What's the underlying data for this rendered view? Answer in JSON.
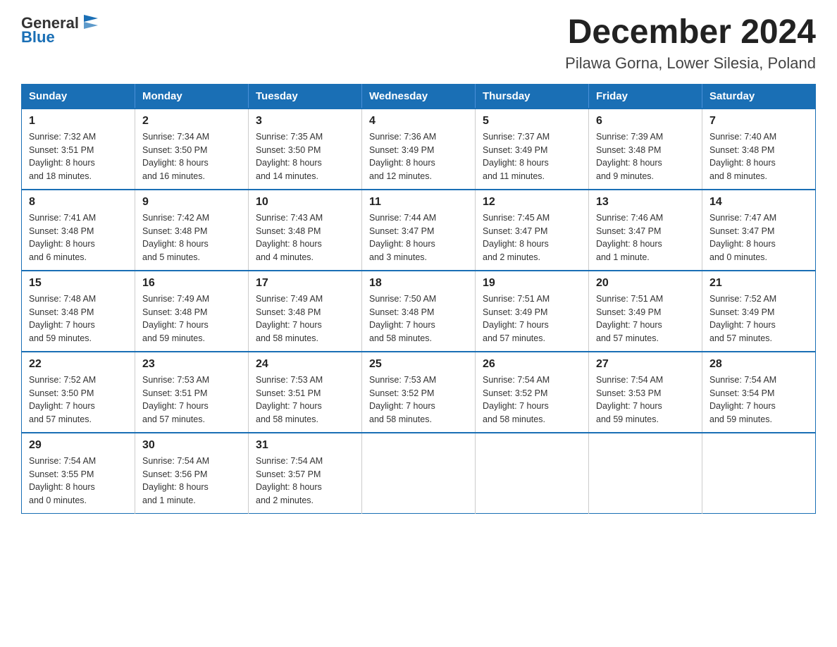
{
  "header": {
    "logo_text_general": "General",
    "logo_text_blue": "Blue",
    "title": "December 2024",
    "subtitle": "Pilawa Gorna, Lower Silesia, Poland"
  },
  "days_of_week": [
    "Sunday",
    "Monday",
    "Tuesday",
    "Wednesday",
    "Thursday",
    "Friday",
    "Saturday"
  ],
  "weeks": [
    [
      {
        "day": "1",
        "sunrise": "7:32 AM",
        "sunset": "3:51 PM",
        "daylight": "8 hours and 18 minutes."
      },
      {
        "day": "2",
        "sunrise": "7:34 AM",
        "sunset": "3:50 PM",
        "daylight": "8 hours and 16 minutes."
      },
      {
        "day": "3",
        "sunrise": "7:35 AM",
        "sunset": "3:50 PM",
        "daylight": "8 hours and 14 minutes."
      },
      {
        "day": "4",
        "sunrise": "7:36 AM",
        "sunset": "3:49 PM",
        "daylight": "8 hours and 12 minutes."
      },
      {
        "day": "5",
        "sunrise": "7:37 AM",
        "sunset": "3:49 PM",
        "daylight": "8 hours and 11 minutes."
      },
      {
        "day": "6",
        "sunrise": "7:39 AM",
        "sunset": "3:48 PM",
        "daylight": "8 hours and 9 minutes."
      },
      {
        "day": "7",
        "sunrise": "7:40 AM",
        "sunset": "3:48 PM",
        "daylight": "8 hours and 8 minutes."
      }
    ],
    [
      {
        "day": "8",
        "sunrise": "7:41 AM",
        "sunset": "3:48 PM",
        "daylight": "8 hours and 6 minutes."
      },
      {
        "day": "9",
        "sunrise": "7:42 AM",
        "sunset": "3:48 PM",
        "daylight": "8 hours and 5 minutes."
      },
      {
        "day": "10",
        "sunrise": "7:43 AM",
        "sunset": "3:48 PM",
        "daylight": "8 hours and 4 minutes."
      },
      {
        "day": "11",
        "sunrise": "7:44 AM",
        "sunset": "3:47 PM",
        "daylight": "8 hours and 3 minutes."
      },
      {
        "day": "12",
        "sunrise": "7:45 AM",
        "sunset": "3:47 PM",
        "daylight": "8 hours and 2 minutes."
      },
      {
        "day": "13",
        "sunrise": "7:46 AM",
        "sunset": "3:47 PM",
        "daylight": "8 hours and 1 minute."
      },
      {
        "day": "14",
        "sunrise": "7:47 AM",
        "sunset": "3:47 PM",
        "daylight": "8 hours and 0 minutes."
      }
    ],
    [
      {
        "day": "15",
        "sunrise": "7:48 AM",
        "sunset": "3:48 PM",
        "daylight": "7 hours and 59 minutes."
      },
      {
        "day": "16",
        "sunrise": "7:49 AM",
        "sunset": "3:48 PM",
        "daylight": "7 hours and 59 minutes."
      },
      {
        "day": "17",
        "sunrise": "7:49 AM",
        "sunset": "3:48 PM",
        "daylight": "7 hours and 58 minutes."
      },
      {
        "day": "18",
        "sunrise": "7:50 AM",
        "sunset": "3:48 PM",
        "daylight": "7 hours and 58 minutes."
      },
      {
        "day": "19",
        "sunrise": "7:51 AM",
        "sunset": "3:49 PM",
        "daylight": "7 hours and 57 minutes."
      },
      {
        "day": "20",
        "sunrise": "7:51 AM",
        "sunset": "3:49 PM",
        "daylight": "7 hours and 57 minutes."
      },
      {
        "day": "21",
        "sunrise": "7:52 AM",
        "sunset": "3:49 PM",
        "daylight": "7 hours and 57 minutes."
      }
    ],
    [
      {
        "day": "22",
        "sunrise": "7:52 AM",
        "sunset": "3:50 PM",
        "daylight": "7 hours and 57 minutes."
      },
      {
        "day": "23",
        "sunrise": "7:53 AM",
        "sunset": "3:51 PM",
        "daylight": "7 hours and 57 minutes."
      },
      {
        "day": "24",
        "sunrise": "7:53 AM",
        "sunset": "3:51 PM",
        "daylight": "7 hours and 58 minutes."
      },
      {
        "day": "25",
        "sunrise": "7:53 AM",
        "sunset": "3:52 PM",
        "daylight": "7 hours and 58 minutes."
      },
      {
        "day": "26",
        "sunrise": "7:54 AM",
        "sunset": "3:52 PM",
        "daylight": "7 hours and 58 minutes."
      },
      {
        "day": "27",
        "sunrise": "7:54 AM",
        "sunset": "3:53 PM",
        "daylight": "7 hours and 59 minutes."
      },
      {
        "day": "28",
        "sunrise": "7:54 AM",
        "sunset": "3:54 PM",
        "daylight": "7 hours and 59 minutes."
      }
    ],
    [
      {
        "day": "29",
        "sunrise": "7:54 AM",
        "sunset": "3:55 PM",
        "daylight": "8 hours and 0 minutes."
      },
      {
        "day": "30",
        "sunrise": "7:54 AM",
        "sunset": "3:56 PM",
        "daylight": "8 hours and 1 minute."
      },
      {
        "day": "31",
        "sunrise": "7:54 AM",
        "sunset": "3:57 PM",
        "daylight": "8 hours and 2 minutes."
      },
      null,
      null,
      null,
      null
    ]
  ],
  "labels": {
    "sunrise": "Sunrise:",
    "sunset": "Sunset:",
    "daylight": "Daylight:"
  }
}
